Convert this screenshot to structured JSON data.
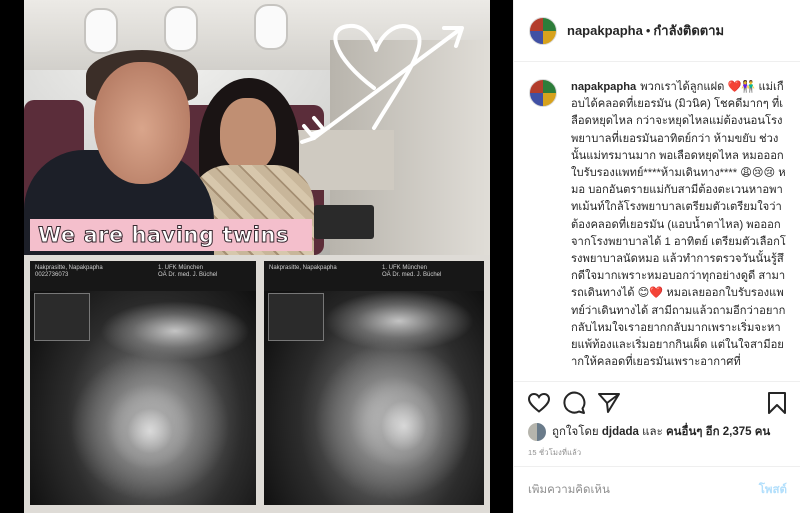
{
  "post_image": {
    "caption_overlay": "We are having twins",
    "scan_left_meta": "Nakprasitte, Napakpapha\n0022736073",
    "scan_left_clinic": "1. UFK München\nOÄ Dr. med. J. Büchel",
    "scan_right_meta": "Nakprasitte, Napakpapha",
    "scan_right_clinic": "1. UFK München\nOÄ Dr. med. J. Büchel"
  },
  "header": {
    "username": "napakpapha",
    "separator": "•",
    "follow_status": "กำลังติดตาม"
  },
  "caption": {
    "username": "napakpapha",
    "text": "พวกเราได้ลูกแฝด ❤️👫 แม่เกือบได้คลอดที่เยอรมัน (มิวนิค) โชคดีมากๆ ที่เลือดหยุดไหล กว่าจะหยุดไหลแม่ต้องนอนโรงพยาบาลที่เยอรมันอาทิตย์กว่า ห้ามขยับ ช่วงนั้นแม่ทรมานมาก พอเลือดหยุดไหล หมอออกใบรับรองแพทย์****ห้ามเดินทาง**** 😩😢😢 หมอ บอกอันตรายแม่กับสามีต้องตะเวนหาอพาทเม้นท์ใกล้โรงพยาบาลเตรียมตัวเตรียมใจว่าต้องคลอดที่เยอรมัน (แอบน้ำตาไหล) พอออกจากโรงพยาบาลได้ 1 อาทิตย์ เตรียมตัวเลือกโรงพยาบาลนัดหมอ แล้วทำการตรวจวันนั้นรู้สึกดีใจมากเพราะหมอบอกว่าทุกอย่างดูดี สามารถเดินทางได้ 😊❤️ หมอเลยออกใบรับรองแพทย์ว่าเดินทางได้ สามีถามแล้วถามอีกว่าอยากกลับไหมใจเราอยากกลับมากเพราะเริ่มจะหายแพ้ท้องและเริ่มอยากกินเผ็ด แต่ในใจสามีอยากให้คลอดที่เยอรมันเพราะอากาศที่"
  },
  "actions": {
    "like_icon": "heart-icon",
    "comment_icon": "comment-icon",
    "share_icon": "share-icon",
    "save_icon": "bookmark-icon"
  },
  "likes": {
    "prefix": "ถูกใจโดย",
    "first_user": "djdada",
    "conjunction": "และ",
    "others": "คนอื่นๆ อีก 2,375 คน"
  },
  "timestamp": "15 ชั่วโมงที่แล้ว",
  "comment_box": {
    "placeholder": "เพิ่มความคิดเห็น",
    "post_label": "โพสต์"
  },
  "colors": {
    "accent_blue_disabled": "#b2dffc",
    "banner_pink": "#f4bfcc",
    "border": "#efefef"
  }
}
